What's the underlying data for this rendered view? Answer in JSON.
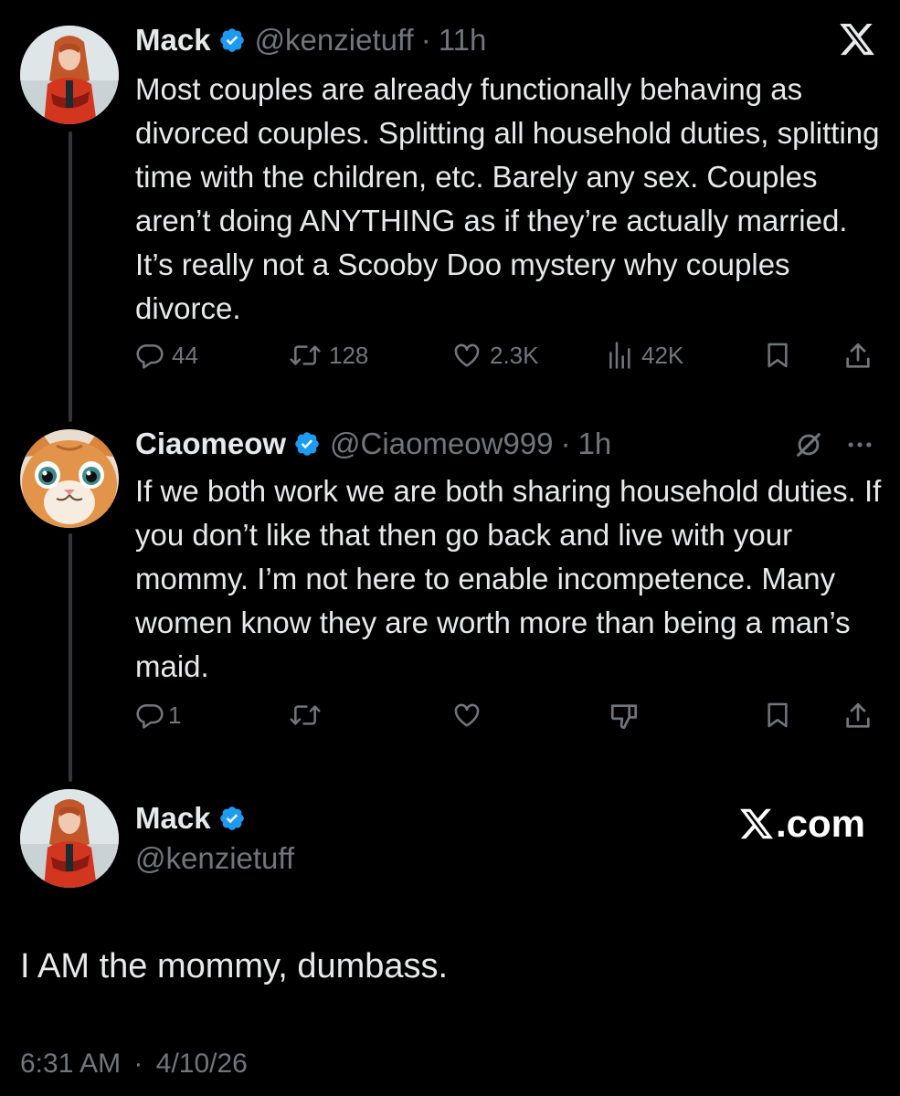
{
  "tweet1": {
    "name": "Mack",
    "handle": "@kenzietuff",
    "separator": "·",
    "time": "11h",
    "text": "Most couples are already functionally behaving as divorced couples. Splitting all household duties, splitting time with the children, etc. Barely any sex. Couples aren’t doing ANYTHING as if they’re actually married. It’s really not a Scooby Doo mystery why couples divorce.",
    "replies": "44",
    "reposts": "128",
    "likes": "2.3K",
    "views": "42K"
  },
  "tweet2": {
    "name": "Ciaomeow",
    "handle": "@Ciaomeow999",
    "separator": "·",
    "time": "1h",
    "text": "If we both work we are both sharing household duties. If you don’t like that then go back and live with your mommy. I’m not here to enable incompetence. Many women know they are worth more than being a man’s maid.",
    "replies": "1"
  },
  "tweet3": {
    "name": "Mack",
    "handle": "@kenzietuff",
    "brand": ".com",
    "text": "I AM the mommy, dumbass.",
    "time": "6:31 AM",
    "separator": "·",
    "date": "4/10/26"
  },
  "colors": {
    "background": "#000000",
    "text": "#e7e9ea",
    "muted": "#71767b",
    "verified": "#1d9bf0",
    "thread_line": "#333639"
  },
  "icons": [
    "x-logo-icon",
    "verified-badge-icon",
    "reply-icon",
    "repost-icon",
    "like-icon",
    "views-icon",
    "bookmark-icon",
    "share-icon",
    "grok-icon",
    "more-icon",
    "dislike-icon"
  ]
}
